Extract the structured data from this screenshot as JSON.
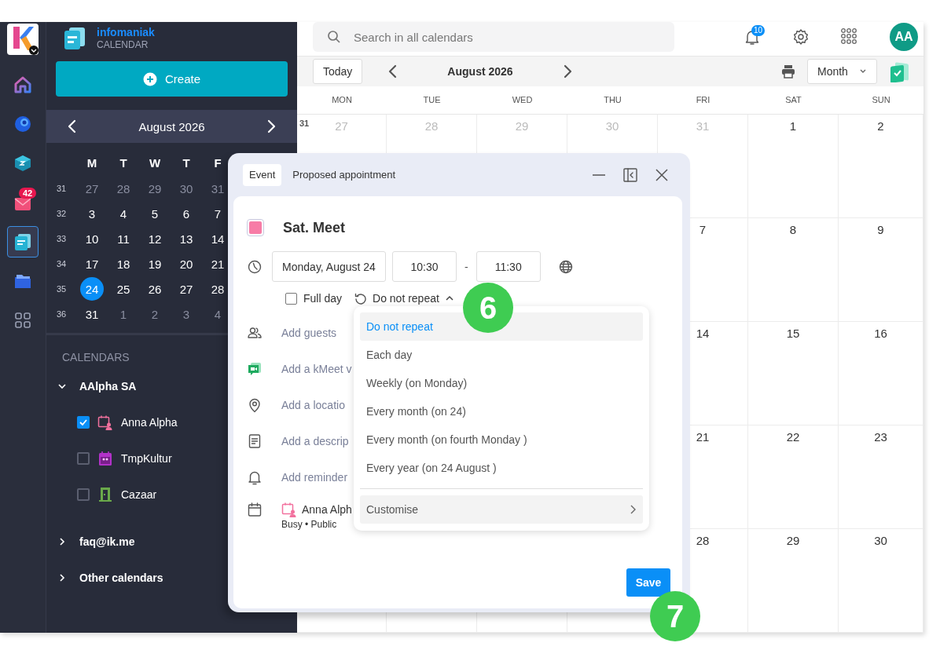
{
  "rail": [
    {
      "kind": "logo",
      "selected": false
    },
    {
      "kind": "home",
      "selected": false
    },
    {
      "kind": "orb",
      "selected": false
    },
    {
      "kind": "cube",
      "selected": false
    },
    {
      "kind": "mail",
      "selected": false,
      "badge": "42"
    },
    {
      "kind": "calendar",
      "selected": true
    },
    {
      "kind": "folders",
      "selected": false
    },
    {
      "kind": "apps",
      "selected": false
    }
  ],
  "sidebar": {
    "brand": "infomaniak",
    "product": "CALENDAR",
    "create_button": "Create",
    "mini_calendar": {
      "title": "August 2026",
      "weekdays": [
        "M",
        "T",
        "W",
        "T",
        "F"
      ],
      "weeks": [
        {
          "number": "31",
          "days": [
            {
              "day": "27",
              "outside": true,
              "selected": false
            },
            {
              "day": "28",
              "outside": true,
              "selected": false
            },
            {
              "day": "29",
              "outside": true,
              "selected": false
            },
            {
              "day": "30",
              "outside": true,
              "selected": false
            },
            {
              "day": "31",
              "outside": true,
              "selected": false
            }
          ]
        },
        {
          "number": "32",
          "days": [
            {
              "day": "3",
              "outside": false,
              "selected": false
            },
            {
              "day": "4",
              "outside": false,
              "selected": false
            },
            {
              "day": "5",
              "outside": false,
              "selected": false
            },
            {
              "day": "6",
              "outside": false,
              "selected": false
            },
            {
              "day": "7",
              "outside": false,
              "selected": false
            }
          ]
        },
        {
          "number": "33",
          "days": [
            {
              "day": "10",
              "outside": false,
              "selected": false
            },
            {
              "day": "11",
              "outside": false,
              "selected": false
            },
            {
              "day": "12",
              "outside": false,
              "selected": false
            },
            {
              "day": "13",
              "outside": false,
              "selected": false
            },
            {
              "day": "14",
              "outside": false,
              "selected": false
            }
          ]
        },
        {
          "number": "34",
          "days": [
            {
              "day": "17",
              "outside": false,
              "selected": false
            },
            {
              "day": "18",
              "outside": false,
              "selected": false
            },
            {
              "day": "19",
              "outside": false,
              "selected": false
            },
            {
              "day": "20",
              "outside": false,
              "selected": false
            },
            {
              "day": "21",
              "outside": false,
              "selected": false
            }
          ]
        },
        {
          "number": "35",
          "days": [
            {
              "day": "24",
              "outside": false,
              "selected": true
            },
            {
              "day": "25",
              "outside": false,
              "selected": false
            },
            {
              "day": "26",
              "outside": false,
              "selected": false
            },
            {
              "day": "27",
              "outside": false,
              "selected": false
            },
            {
              "day": "28",
              "outside": false,
              "selected": false
            }
          ]
        },
        {
          "number": "36",
          "days": [
            {
              "day": "31",
              "outside": false,
              "selected": false
            },
            {
              "day": "1",
              "outside": true,
              "selected": false
            },
            {
              "day": "2",
              "outside": true,
              "selected": false
            },
            {
              "day": "3",
              "outside": true,
              "selected": false
            },
            {
              "day": "4",
              "outside": true,
              "selected": false
            }
          ]
        }
      ]
    },
    "calendars_heading": "CALENDARS",
    "groups": [
      {
        "name": "AAlpha SA",
        "expanded": true,
        "children": [
          {
            "name": "Anna Alpha",
            "checked": true,
            "kind": "person",
            "color": "#f2719e"
          },
          {
            "name": "TmpKultur",
            "checked": false,
            "kind": "group",
            "color": "#b232c9"
          },
          {
            "name": "Cazaar",
            "checked": false,
            "kind": "room",
            "color": "#6aa94a"
          }
        ]
      },
      {
        "name": "faq@ik.me",
        "expanded": false
      },
      {
        "name": "Other calendars",
        "expanded": false
      }
    ]
  },
  "topbar": {
    "search_placeholder": "Search in all calendars",
    "notifications": "10",
    "avatar": "AA"
  },
  "toolbar": {
    "today": "Today",
    "title": "August 2026",
    "view": "Month"
  },
  "month": {
    "weekdays": [
      "MON",
      "TUE",
      "WED",
      "THU",
      "FRI",
      "SAT",
      "SUN"
    ],
    "weeks": [
      {
        "number": "31",
        "days": [
          {
            "day": "27",
            "outside": true
          },
          {
            "day": "28",
            "outside": true
          },
          {
            "day": "29",
            "outside": true
          },
          {
            "day": "30",
            "outside": true
          },
          {
            "day": "31",
            "outside": true
          },
          {
            "day": "1",
            "outside": false
          },
          {
            "day": "2",
            "outside": false
          }
        ]
      },
      {
        "days": [
          {
            "day": "7",
            "outside": false
          },
          {
            "day": "8",
            "outside": false
          },
          {
            "day": "9",
            "outside": false
          }
        ]
      },
      {
        "days": [
          {
            "day": "14",
            "outside": false
          },
          {
            "day": "15",
            "outside": false
          },
          {
            "day": "16",
            "outside": false
          }
        ]
      },
      {
        "days": [
          {
            "day": "21",
            "outside": false
          },
          {
            "day": "22",
            "outside": false
          },
          {
            "day": "23",
            "outside": false
          }
        ]
      },
      {
        "days": [
          {
            "day": "28",
            "outside": false
          },
          {
            "day": "29",
            "outside": false
          },
          {
            "day": "30",
            "outside": false
          }
        ]
      }
    ]
  },
  "dialog": {
    "tabs": [
      {
        "label": "Event",
        "selected": true
      },
      {
        "label": "Proposed appointment",
        "selected": false
      }
    ],
    "color": "#f77ca6",
    "title": "Sat. Meet",
    "date": "Monday, August 24",
    "start": "10:30",
    "separator": "-",
    "end": "11:30",
    "full_day": {
      "label": "Full day",
      "checked": false
    },
    "repeat": {
      "label": "Do not repeat",
      "expanded": true
    },
    "options": [
      {
        "kind": "guests",
        "label": "Add guests"
      },
      {
        "kind": "video",
        "label": "Add a kMeet v"
      },
      {
        "kind": "location",
        "label": "Add a locatio"
      },
      {
        "kind": "description",
        "label": "Add a descrip"
      },
      {
        "kind": "reminder",
        "label": "Add reminder"
      }
    ],
    "calendar": {
      "name": "Anna Alph",
      "meta": "Busy • Public"
    },
    "repeat_menu": {
      "items": [
        {
          "label": "Do not repeat",
          "selected": true
        },
        {
          "label": "Each day",
          "selected": false
        },
        {
          "label": "Weekly (on Monday)",
          "selected": false
        },
        {
          "label": "Every month (on 24)",
          "selected": false
        },
        {
          "label": "Every month (on fourth Monday )",
          "selected": false
        },
        {
          "label": "Every year (on 24 August )",
          "selected": false
        }
      ],
      "customise": "Customise"
    },
    "save": "Save"
  },
  "callouts": [
    {
      "label": "6"
    },
    {
      "label": "7"
    }
  ]
}
